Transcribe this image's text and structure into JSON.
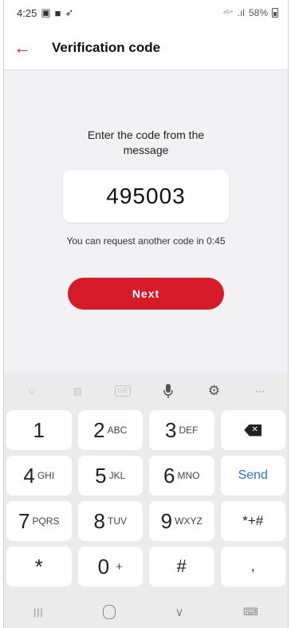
{
  "status": {
    "time": "4:25",
    "signal_text": "⁴ᴳ⁺",
    "battery": "58%"
  },
  "header": {
    "title": "Verification code"
  },
  "main": {
    "prompt": "Enter the code from the message",
    "code": "495003",
    "hint": "You can request another code in 0:45",
    "next_label": "Next"
  },
  "keyboard": {
    "toolbar": {
      "emoji_icon": "emoji-icon",
      "sticker_icon": "sticker-icon",
      "gif_label": "GIF",
      "mic_icon": "microphone-icon",
      "settings_icon": "gear-icon",
      "more_label": "···"
    },
    "rows": [
      [
        {
          "num": "1",
          "letters": ""
        },
        {
          "num": "2",
          "letters": "ABC"
        },
        {
          "num": "3",
          "letters": "DEF"
        },
        {
          "icon": "backspace-icon"
        }
      ],
      [
        {
          "num": "4",
          "letters": "GHI"
        },
        {
          "num": "5",
          "letters": "JKL"
        },
        {
          "num": "6",
          "letters": "MNO"
        },
        {
          "label": "Send"
        }
      ],
      [
        {
          "num": "7",
          "letters": "PQRS"
        },
        {
          "num": "8",
          "letters": "TUV"
        },
        {
          "num": "9",
          "letters": "WXYZ"
        },
        {
          "label": "*+#"
        }
      ],
      [
        {
          "num": "*",
          "letters": ""
        },
        {
          "num": "0",
          "letters": "+"
        },
        {
          "num": "#",
          "letters": ""
        },
        {
          "label": ","
        }
      ]
    ]
  },
  "navbar": {
    "recents": "|||",
    "back": "∨",
    "keyboard_switch": "⌨"
  },
  "colors": {
    "brand_red": "#d51b2a",
    "send_blue": "#2d6fd6"
  }
}
